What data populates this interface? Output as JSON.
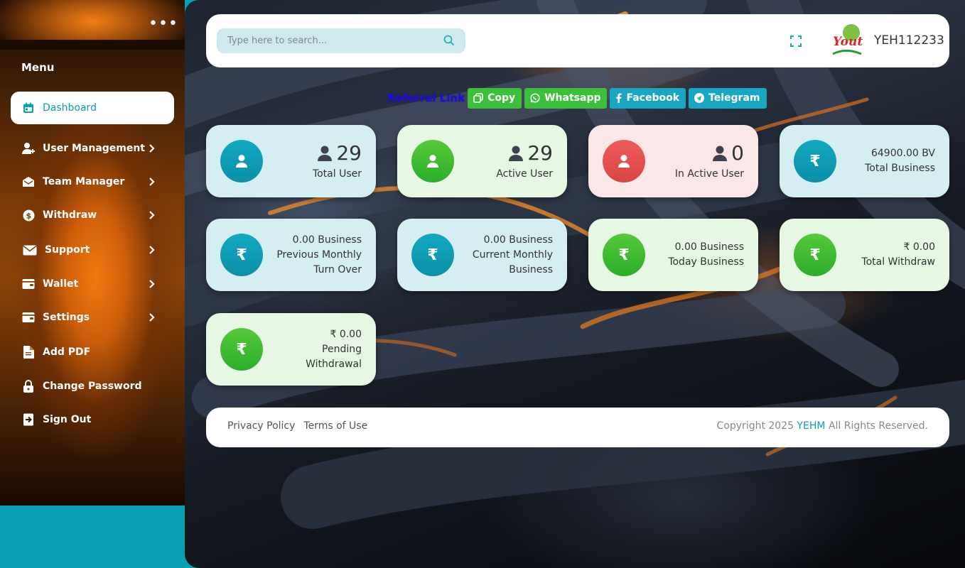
{
  "sidebar": {
    "menu_title": "Menu",
    "more_icon": "more-horizontal-icon",
    "items": [
      {
        "label": "Dashboard",
        "icon": "calendar-icon",
        "active": true,
        "has_submenu": false
      },
      {
        "label": "User Management",
        "icon": "user-plus-icon",
        "active": false,
        "has_submenu": true
      },
      {
        "label": "Team Manager",
        "icon": "envelope-open-icon",
        "active": false,
        "has_submenu": true
      },
      {
        "label": "Withdraw",
        "icon": "coin-icon",
        "active": false,
        "has_submenu": true
      },
      {
        "label": "Support",
        "icon": "mail-icon",
        "active": false,
        "has_submenu": true
      },
      {
        "label": "Wallet",
        "icon": "wallet-icon",
        "active": false,
        "has_submenu": true
      },
      {
        "label": "Settings",
        "icon": "settings-icon",
        "active": false,
        "has_submenu": true
      },
      {
        "label": "Add PDF",
        "icon": "file-icon",
        "active": false,
        "has_submenu": false
      },
      {
        "label": "Change Password",
        "icon": "lock-icon",
        "active": false,
        "has_submenu": false
      },
      {
        "label": "Sign Out",
        "icon": "sign-out-icon",
        "active": false,
        "has_submenu": false
      }
    ]
  },
  "header": {
    "search_placeholder": "Type here to search...",
    "username": "YEH112233",
    "logo_text": "Youth"
  },
  "referral": {
    "title": "Referral Link",
    "buttons": [
      {
        "label": "Copy",
        "icon": "copy-icon",
        "color": "#3cbf3a"
      },
      {
        "label": "Whatsapp",
        "icon": "whatsapp-icon",
        "color": "#3cbf3a"
      },
      {
        "label": "Facebook",
        "icon": "facebook-icon",
        "color": "#18a6c0"
      },
      {
        "label": "Telegram",
        "icon": "telegram-icon",
        "color": "#18a6c0"
      }
    ]
  },
  "cards": [
    {
      "count": "29",
      "label": "Total User",
      "theme": "teal"
    },
    {
      "count": "29",
      "label": "Active User",
      "theme": "green"
    },
    {
      "count": "0",
      "label": "In Active User",
      "theme": "red"
    },
    {
      "line1": "64900.00 BV",
      "line2": "Total Business",
      "theme": "teal"
    },
    {
      "line1": "0.00 Business",
      "line2": "Previous Monthly",
      "line3": "Turn Over",
      "theme": "teal"
    },
    {
      "line1": "0.00 Business",
      "line2": "Current Monthly",
      "line3": "Business",
      "theme": "teal"
    },
    {
      "line1": "0.00 Business",
      "line2": "Today Business",
      "theme": "green"
    },
    {
      "line1": "₹ 0.00",
      "line2": "Total Withdraw",
      "theme": "green"
    },
    {
      "line1": "₹ 0.00",
      "line2": "Pending",
      "line3": "Withdrawal",
      "theme": "green"
    }
  ],
  "footer": {
    "links": [
      "Privacy Policy",
      "Terms of Use"
    ],
    "copyright_prefix": "Copyright 2025",
    "brand": "YEHM",
    "copyright_suffix": "All Rights Reserved."
  },
  "colors": {
    "accent": "#0aa0b4",
    "referral_title": "#1e0af0",
    "green": "#3cbf3a",
    "red": "#e05050"
  }
}
